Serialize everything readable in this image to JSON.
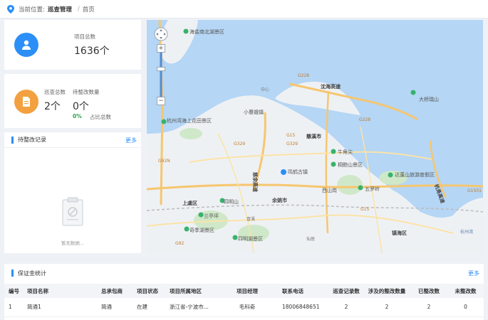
{
  "breadcrumb": {
    "prefix": "当前位置:",
    "section": "巡查管理",
    "separator": "/",
    "page": "首页"
  },
  "stats": {
    "project": {
      "label": "项目总数",
      "value": "1636个"
    },
    "inspect": {
      "label": "巡查总数",
      "value": "2个"
    },
    "pending": {
      "label": "待整改数量",
      "value": "0个",
      "percent": "0%",
      "percent_label": "占比总数"
    }
  },
  "rectify_panel": {
    "title": "待整改记录",
    "more": "更多",
    "empty_text": "暂无数据..."
  },
  "map": {
    "labels": [
      {
        "text": "海盐南北湖景区"
      },
      {
        "text": "沈海高速"
      },
      {
        "text": "G228"
      },
      {
        "text": "G228"
      },
      {
        "text": "中心"
      },
      {
        "text": "大桥瑞山"
      },
      {
        "text": "杭州湾海上花田景区"
      },
      {
        "text": "小曹娥镇"
      },
      {
        "text": "慈溪市"
      },
      {
        "text": "G15"
      },
      {
        "text": "G329"
      },
      {
        "text": "G329"
      },
      {
        "text": "慈余高速"
      },
      {
        "text": "牛角尖"
      },
      {
        "text": "鸣鹤古镇"
      },
      {
        "text": "桐鲍山景区"
      },
      {
        "text": "达蓬山旅游度假区"
      },
      {
        "text": "西山岗"
      },
      {
        "text": "五罗岭"
      },
      {
        "text": "G92N"
      },
      {
        "text": "上虞区"
      },
      {
        "text": "余姚市"
      },
      {
        "text": "四明山"
      },
      {
        "text": "兰亭坪"
      },
      {
        "text": "仙居"
      },
      {
        "text": "四明湖景区"
      },
      {
        "text": "冒溪"
      },
      {
        "text": "奇季湖景区"
      },
      {
        "text": "G92"
      },
      {
        "text": "镇海区"
      },
      {
        "text": "杭甬高速"
      },
      {
        "text": "G15"
      },
      {
        "text": "G1501"
      },
      {
        "text": "杭州湾"
      }
    ]
  },
  "deposit": {
    "title": "保证金统计",
    "more": "更多",
    "columns": [
      "编号",
      "项目名称",
      "总承包商",
      "项目状态",
      "项目所属地区",
      "项目经理",
      "联系电话",
      "巡查记录数",
      "涉及的整改数量",
      "已整改数",
      "未整改数"
    ],
    "rows": [
      [
        "1",
        "简通1",
        "简通",
        "在建",
        "浙江省-宁波市...",
        "毛科奇",
        "18006848651",
        "2",
        "2",
        "2",
        "0"
      ]
    ]
  },
  "colors": {
    "accent": "#2b8ff7",
    "project_icon": "#2b8ff7",
    "inspect_icon": "#f2a040",
    "percent_green": "#2ea44f",
    "sea": "#b5d6f5"
  }
}
